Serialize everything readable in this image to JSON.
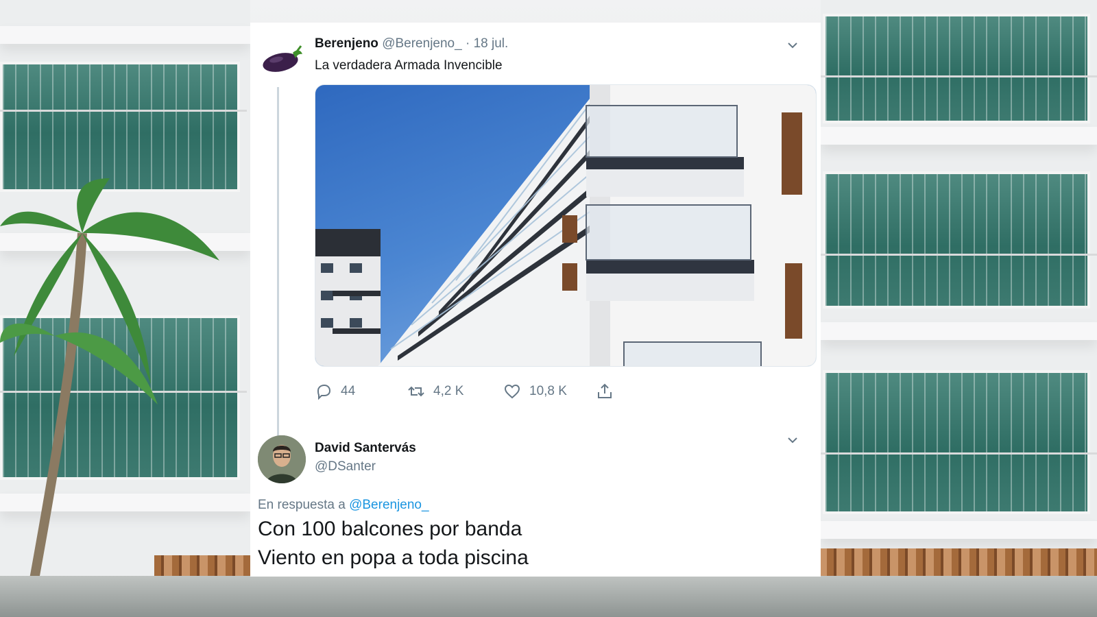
{
  "tweet": {
    "author_name": "Berenjeno",
    "author_handle": "@Berenjeno_",
    "separator": "·",
    "date": "18 jul.",
    "text": "La verdadera Armada Invencible",
    "avatar_icon": "eggplant-icon",
    "media_description": "apartment-building-balconies-photo",
    "actions": {
      "replies": "44",
      "retweets": "4,2 K",
      "likes": "10,8 K"
    },
    "icons": {
      "reply": "speech-bubble-icon",
      "retweet": "retweet-icon",
      "like": "heart-icon",
      "share": "share-icon",
      "menu": "chevron-down-icon"
    }
  },
  "reply": {
    "author_name": "David Santervás",
    "author_handle": "@DSanter",
    "in_reply_prefix": "En respuesta a",
    "in_reply_to": "@Berenjeno_",
    "lines": [
      "Con 100 balcones por banda",
      "Viento en popa a toda piscina"
    ]
  },
  "colors": {
    "link": "#1b95e0",
    "secondary_text": "#657786",
    "primary_text": "#14171a"
  }
}
